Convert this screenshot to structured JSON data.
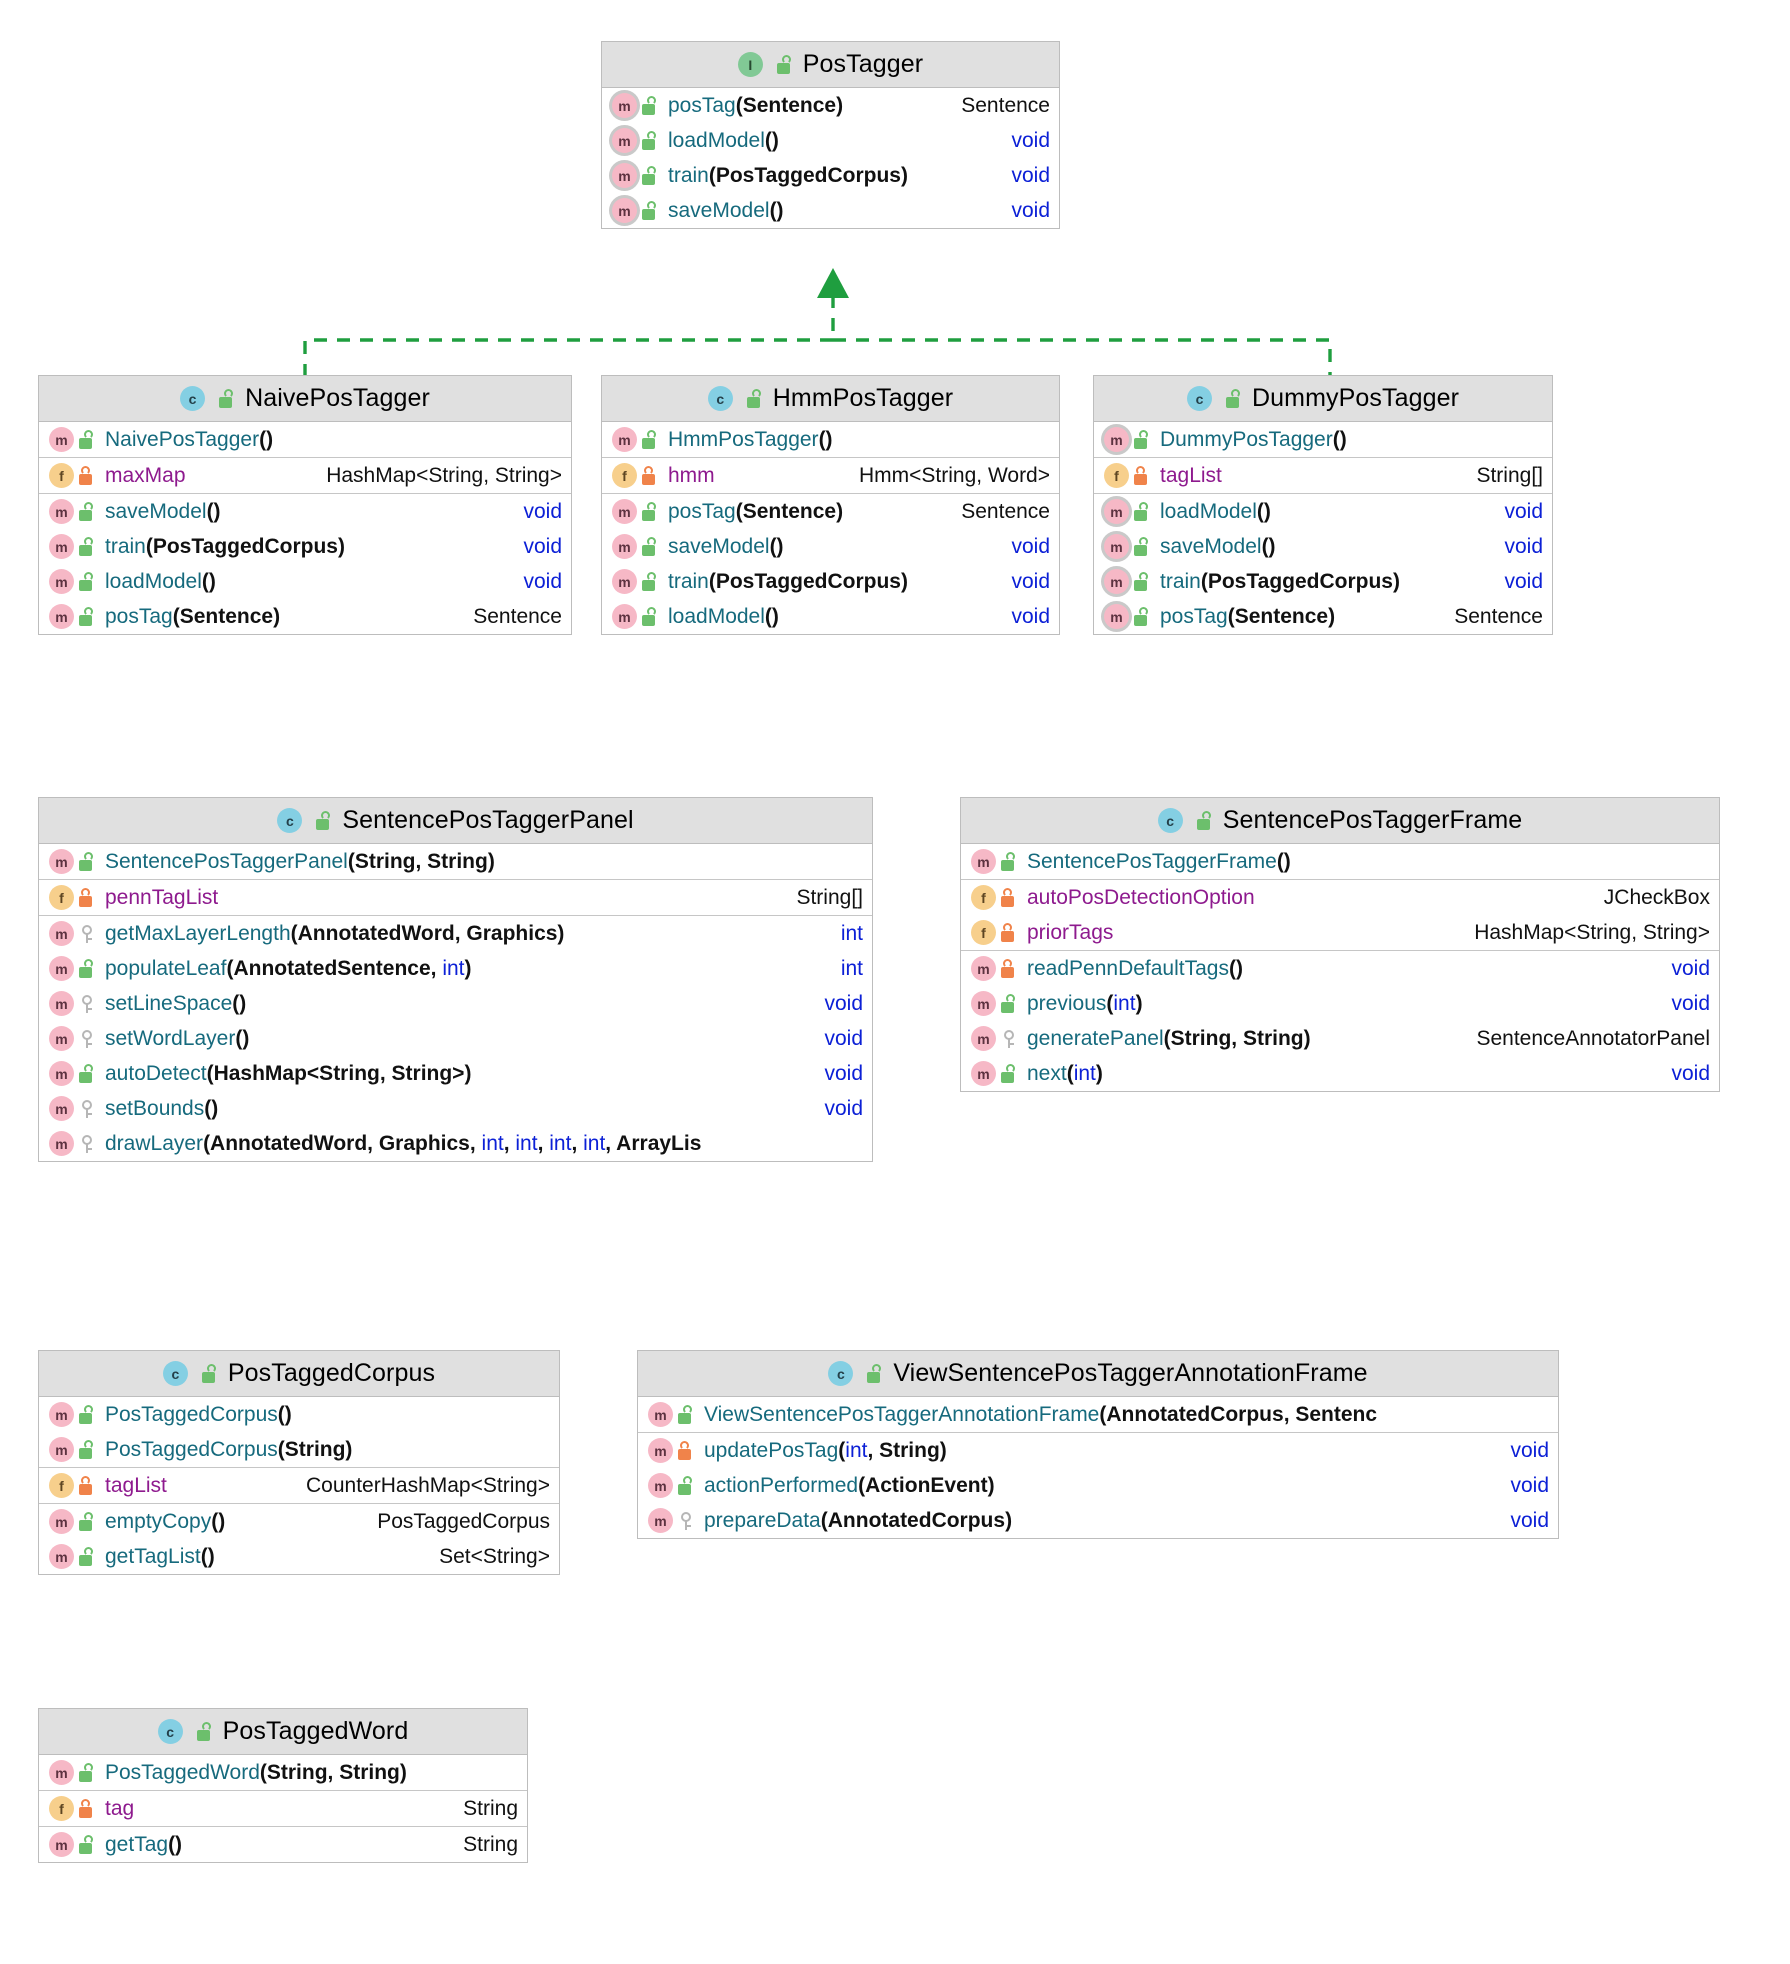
{
  "diagram": {
    "kind": "uml-class-diagram",
    "colors": {
      "header_bg": "#e0e0e0",
      "box_border": "#bdbdbd",
      "member_name": "#166a7d",
      "field_name": "#8e1a8e",
      "keyword": "#0c20d6",
      "relation_line": "#1f9e3f",
      "class_badge": "#84cfe3",
      "interface_badge": "#81c995",
      "method_badge": "#f6b8c6",
      "field_badge": "#f7cf8c",
      "lock_public": "#6cbf6c",
      "lock_private": "#f0834a",
      "lock_protected": "#b6b6b6"
    },
    "relations": [
      {
        "type": "realization",
        "from": "NaivePosTagger",
        "to": "PosTagger",
        "style": "dashed",
        "arrow": "closed-triangle"
      },
      {
        "type": "realization",
        "from": "HmmPosTagger",
        "to": "PosTagger",
        "style": "dashed",
        "arrow": "closed-triangle"
      },
      {
        "type": "realization",
        "from": "DummyPosTagger",
        "to": "PosTagger",
        "style": "dashed",
        "arrow": "closed-triangle"
      }
    ]
  },
  "boxes": [
    {
      "id": "postagger",
      "name": "PosTagger",
      "stereotype": "interface",
      "badge": "I",
      "badge_kind": "iface",
      "header_lock": "pub",
      "sections": [
        {
          "rows": [
            {
              "icon": "m",
              "ring": true,
              "lock": "pub",
              "name": "posTag",
              "name_kind": "method",
              "params": "(Sentence)",
              "ret": "Sentence",
              "ret_kind": "type"
            },
            {
              "icon": "m",
              "ring": true,
              "lock": "pub",
              "name": "loadModel",
              "name_kind": "method",
              "params": "()",
              "ret": "void",
              "ret_kind": "kw"
            },
            {
              "icon": "m",
              "ring": true,
              "lock": "pub",
              "name": "train",
              "name_kind": "method",
              "params": "(PosTaggedCorpus)",
              "ret": "void",
              "ret_kind": "kw"
            },
            {
              "icon": "m",
              "ring": true,
              "lock": "pub",
              "name": "saveModel",
              "name_kind": "method",
              "params": "()",
              "ret": "void",
              "ret_kind": "kw"
            }
          ]
        }
      ]
    },
    {
      "id": "naivepostagger",
      "name": "NaivePosTagger",
      "stereotype": "class",
      "badge": "c",
      "badge_kind": "cls",
      "header_lock": "pub",
      "sections": [
        {
          "rows": [
            {
              "icon": "m",
              "ring": false,
              "lock": "pub",
              "name": "NaivePosTagger",
              "name_kind": "method",
              "params": "()",
              "ret": "",
              "ret_kind": "type"
            }
          ]
        },
        {
          "rows": [
            {
              "icon": "f",
              "ring": false,
              "lock": "priv",
              "name": "maxMap",
              "name_kind": "field",
              "params": "",
              "ret": "HashMap<String, String>",
              "ret_kind": "type"
            }
          ]
        },
        {
          "rows": [
            {
              "icon": "m",
              "ring": false,
              "lock": "pub",
              "name": "saveModel",
              "name_kind": "method",
              "params": "()",
              "ret": "void",
              "ret_kind": "kw"
            },
            {
              "icon": "m",
              "ring": false,
              "lock": "pub",
              "name": "train",
              "name_kind": "method",
              "params": "(PosTaggedCorpus)",
              "ret": "void",
              "ret_kind": "kw"
            },
            {
              "icon": "m",
              "ring": false,
              "lock": "pub",
              "name": "loadModel",
              "name_kind": "method",
              "params": "()",
              "ret": "void",
              "ret_kind": "kw"
            },
            {
              "icon": "m",
              "ring": false,
              "lock": "pub",
              "name": "posTag",
              "name_kind": "method",
              "params": "(Sentence)",
              "ret": "Sentence",
              "ret_kind": "type"
            }
          ]
        }
      ]
    },
    {
      "id": "hmmpostagger",
      "name": "HmmPosTagger",
      "stereotype": "class",
      "badge": "c",
      "badge_kind": "cls",
      "header_lock": "pub",
      "sections": [
        {
          "rows": [
            {
              "icon": "m",
              "ring": false,
              "lock": "pub",
              "name": "HmmPosTagger",
              "name_kind": "method",
              "params": "()",
              "ret": "",
              "ret_kind": "type"
            }
          ]
        },
        {
          "rows": [
            {
              "icon": "f",
              "ring": false,
              "lock": "priv",
              "name": "hmm",
              "name_kind": "field",
              "params": "",
              "ret": "Hmm<String, Word>",
              "ret_kind": "type"
            }
          ]
        },
        {
          "rows": [
            {
              "icon": "m",
              "ring": false,
              "lock": "pub",
              "name": "posTag",
              "name_kind": "method",
              "params": "(Sentence)",
              "ret": "Sentence",
              "ret_kind": "type"
            },
            {
              "icon": "m",
              "ring": false,
              "lock": "pub",
              "name": "saveModel",
              "name_kind": "method",
              "params": "()",
              "ret": "void",
              "ret_kind": "kw"
            },
            {
              "icon": "m",
              "ring": false,
              "lock": "pub",
              "name": "train",
              "name_kind": "method",
              "params": "(PosTaggedCorpus)",
              "ret": "void",
              "ret_kind": "kw"
            },
            {
              "icon": "m",
              "ring": false,
              "lock": "pub",
              "name": "loadModel",
              "name_kind": "method",
              "params": "()",
              "ret": "void",
              "ret_kind": "kw"
            }
          ]
        }
      ]
    },
    {
      "id": "dummypostagger",
      "name": "DummyPosTagger",
      "stereotype": "class",
      "badge": "c",
      "badge_kind": "cls",
      "header_lock": "pub",
      "sections": [
        {
          "rows": [
            {
              "icon": "m",
              "ring": true,
              "lock": "pub",
              "name": "DummyPosTagger",
              "name_kind": "method",
              "params": "()",
              "ret": "",
              "ret_kind": "type"
            }
          ]
        },
        {
          "rows": [
            {
              "icon": "f",
              "ring": false,
              "lock": "priv",
              "name": "tagList",
              "name_kind": "field",
              "params": "",
              "ret": "String[]",
              "ret_kind": "type"
            }
          ]
        },
        {
          "rows": [
            {
              "icon": "m",
              "ring": true,
              "lock": "pub",
              "name": "loadModel",
              "name_kind": "method",
              "params": "()",
              "ret": "void",
              "ret_kind": "kw"
            },
            {
              "icon": "m",
              "ring": true,
              "lock": "pub",
              "name": "saveModel",
              "name_kind": "method",
              "params": "()",
              "ret": "void",
              "ret_kind": "kw"
            },
            {
              "icon": "m",
              "ring": true,
              "lock": "pub",
              "name": "train",
              "name_kind": "method",
              "params": "(PosTaggedCorpus)",
              "ret": "void",
              "ret_kind": "kw"
            },
            {
              "icon": "m",
              "ring": true,
              "lock": "pub",
              "name": "posTag",
              "name_kind": "method",
              "params": "(Sentence)",
              "ret": "Sentence",
              "ret_kind": "type"
            }
          ]
        }
      ]
    },
    {
      "id": "sentencepostaggerpanel",
      "name": "SentencePosTaggerPanel",
      "stereotype": "class",
      "badge": "c",
      "badge_kind": "cls",
      "header_lock": "pub",
      "sections": [
        {
          "rows": [
            {
              "icon": "m",
              "ring": false,
              "lock": "pub",
              "name": "SentencePosTaggerPanel",
              "name_kind": "method",
              "params": "(String, String)",
              "ret": "",
              "ret_kind": "type"
            }
          ]
        },
        {
          "rows": [
            {
              "icon": "f",
              "ring": false,
              "lock": "priv",
              "name": "pennTagList",
              "name_kind": "field",
              "params": "",
              "ret": "String[]",
              "ret_kind": "type"
            }
          ]
        },
        {
          "rows": [
            {
              "icon": "m",
              "ring": false,
              "lock": "prot",
              "name": "getMaxLayerLength",
              "name_kind": "method",
              "params": "(AnnotatedWord, Graphics)",
              "ret": "int",
              "ret_kind": "kw"
            },
            {
              "icon": "m",
              "ring": false,
              "lock": "pub",
              "name": "populateLeaf",
              "name_kind": "method",
              "params": "(AnnotatedSentence, int)",
              "ret": "int",
              "ret_kind": "kw",
              "param_kw": [
                "int"
              ]
            },
            {
              "icon": "m",
              "ring": false,
              "lock": "prot",
              "name": "setLineSpace",
              "name_kind": "method",
              "params": "()",
              "ret": "void",
              "ret_kind": "kw"
            },
            {
              "icon": "m",
              "ring": false,
              "lock": "prot",
              "name": "setWordLayer",
              "name_kind": "method",
              "params": "()",
              "ret": "void",
              "ret_kind": "kw"
            },
            {
              "icon": "m",
              "ring": false,
              "lock": "pub",
              "name": "autoDetect",
              "name_kind": "method",
              "params": "(HashMap<String, String>)",
              "ret": "void",
              "ret_kind": "kw"
            },
            {
              "icon": "m",
              "ring": false,
              "lock": "prot",
              "name": "setBounds",
              "name_kind": "method",
              "params": "()",
              "ret": "void",
              "ret_kind": "kw"
            },
            {
              "icon": "m",
              "ring": false,
              "lock": "prot",
              "name": "drawLayer",
              "name_kind": "method",
              "params": "(AnnotatedWord, Graphics, int, int, int, int, ArrayLis",
              "ret": "",
              "ret_kind": "type",
              "param_kw": [
                "int",
                "int",
                "int",
                "int"
              ],
              "clipped": true
            }
          ]
        }
      ]
    },
    {
      "id": "sentencepostaggerframe",
      "name": "SentencePosTaggerFrame",
      "stereotype": "class",
      "badge": "c",
      "badge_kind": "cls",
      "header_lock": "pub",
      "sections": [
        {
          "rows": [
            {
              "icon": "m",
              "ring": false,
              "lock": "pub",
              "name": "SentencePosTaggerFrame",
              "name_kind": "method",
              "params": "()",
              "ret": "",
              "ret_kind": "type"
            }
          ]
        },
        {
          "rows": [
            {
              "icon": "f",
              "ring": false,
              "lock": "priv",
              "name": "autoPosDetectionOption",
              "name_kind": "field",
              "params": "",
              "ret": "JCheckBox",
              "ret_kind": "type"
            },
            {
              "icon": "f",
              "ring": false,
              "lock": "priv",
              "name": "priorTags",
              "name_kind": "field",
              "params": "",
              "ret": "HashMap<String, String>",
              "ret_kind": "type"
            }
          ]
        },
        {
          "rows": [
            {
              "icon": "m",
              "ring": false,
              "lock": "priv",
              "name": "readPennDefaultTags",
              "name_kind": "method",
              "params": "()",
              "ret": "void",
              "ret_kind": "kw"
            },
            {
              "icon": "m",
              "ring": false,
              "lock": "pub",
              "name": "previous",
              "name_kind": "method",
              "params": "(int)",
              "ret": "void",
              "ret_kind": "kw",
              "param_kw": [
                "int"
              ]
            },
            {
              "icon": "m",
              "ring": false,
              "lock": "prot",
              "name": "generatePanel",
              "name_kind": "method",
              "params": "(String, String)",
              "ret": "SentenceAnnotatorPanel",
              "ret_kind": "type"
            },
            {
              "icon": "m",
              "ring": false,
              "lock": "pub",
              "name": "next",
              "name_kind": "method",
              "params": "(int)",
              "ret": "void",
              "ret_kind": "kw",
              "param_kw": [
                "int"
              ]
            }
          ]
        }
      ]
    },
    {
      "id": "postaggedcorpus",
      "name": "PosTaggedCorpus",
      "stereotype": "class",
      "badge": "c",
      "badge_kind": "cls",
      "header_lock": "pub",
      "sections": [
        {
          "rows": [
            {
              "icon": "m",
              "ring": false,
              "lock": "pub",
              "name": "PosTaggedCorpus",
              "name_kind": "method",
              "params": "()",
              "ret": "",
              "ret_kind": "type"
            },
            {
              "icon": "m",
              "ring": false,
              "lock": "pub",
              "name": "PosTaggedCorpus",
              "name_kind": "method",
              "params": "(String)",
              "ret": "",
              "ret_kind": "type"
            }
          ]
        },
        {
          "rows": [
            {
              "icon": "f",
              "ring": false,
              "lock": "priv",
              "name": "tagList",
              "name_kind": "field",
              "params": "",
              "ret": "CounterHashMap<String>",
              "ret_kind": "type"
            }
          ]
        },
        {
          "rows": [
            {
              "icon": "m",
              "ring": false,
              "lock": "pub",
              "name": "emptyCopy",
              "name_kind": "method",
              "params": "()",
              "ret": "PosTaggedCorpus",
              "ret_kind": "type"
            },
            {
              "icon": "m",
              "ring": false,
              "lock": "pub",
              "name": "getTagList",
              "name_kind": "method",
              "params": "()",
              "ret": "Set<String>",
              "ret_kind": "type"
            }
          ]
        }
      ]
    },
    {
      "id": "viewsentencepostaggerannotationframe",
      "name": "ViewSentencePosTaggerAnnotationFrame",
      "stereotype": "class",
      "badge": "c",
      "badge_kind": "cls",
      "header_lock": "pub",
      "sections": [
        {
          "rows": [
            {
              "icon": "m",
              "ring": false,
              "lock": "pub",
              "name": "ViewSentencePosTaggerAnnotationFrame",
              "name_kind": "method",
              "params": "(AnnotatedCorpus, Sentenc",
              "ret": "",
              "ret_kind": "type",
              "clipped": true
            }
          ]
        },
        {
          "rows": [
            {
              "icon": "m",
              "ring": false,
              "lock": "priv",
              "name": "updatePosTag",
              "name_kind": "method",
              "params": "(int, String)",
              "ret": "void",
              "ret_kind": "kw",
              "param_kw": [
                "int"
              ]
            },
            {
              "icon": "m",
              "ring": false,
              "lock": "pub",
              "name": "actionPerformed",
              "name_kind": "method",
              "params": "(ActionEvent)",
              "ret": "void",
              "ret_kind": "kw"
            },
            {
              "icon": "m",
              "ring": false,
              "lock": "prot",
              "name": "prepareData",
              "name_kind": "method",
              "params": "(AnnotatedCorpus)",
              "ret": "void",
              "ret_kind": "kw"
            }
          ]
        }
      ]
    },
    {
      "id": "postaggedword",
      "name": "PosTaggedWord",
      "stereotype": "class",
      "badge": "c",
      "badge_kind": "cls",
      "header_lock": "pub",
      "sections": [
        {
          "rows": [
            {
              "icon": "m",
              "ring": false,
              "lock": "pub",
              "name": "PosTaggedWord",
              "name_kind": "method",
              "params": "(String, String)",
              "ret": "",
              "ret_kind": "type"
            }
          ]
        },
        {
          "rows": [
            {
              "icon": "f",
              "ring": false,
              "lock": "priv",
              "name": "tag",
              "name_kind": "field",
              "params": "",
              "ret": "String",
              "ret_kind": "type"
            }
          ]
        },
        {
          "rows": [
            {
              "icon": "m",
              "ring": false,
              "lock": "pub",
              "name": "getTag",
              "name_kind": "method",
              "params": "()",
              "ret": "String",
              "ret_kind": "type"
            }
          ]
        }
      ]
    }
  ]
}
